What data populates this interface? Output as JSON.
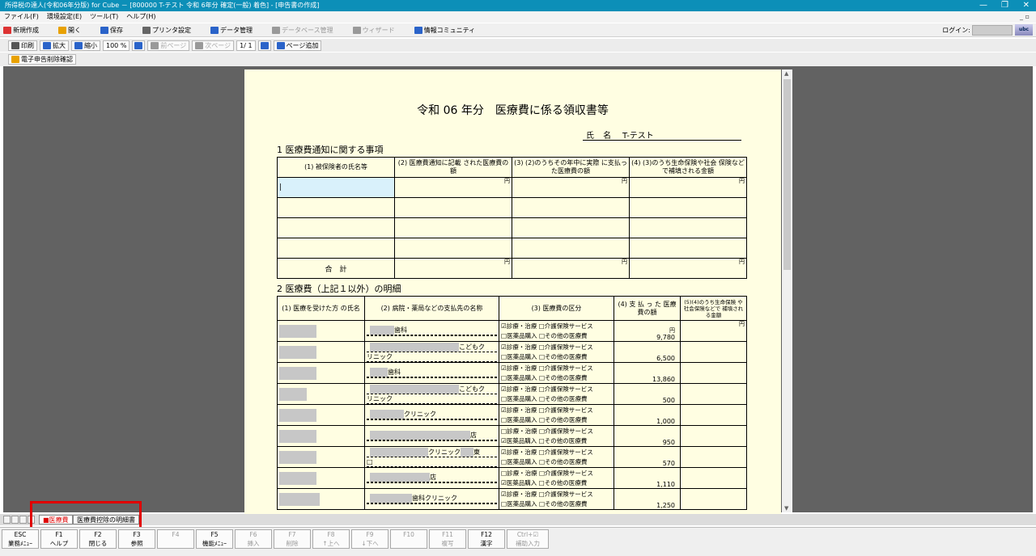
{
  "window": {
    "title": "所得税の達人(令和06年分版) for Cube － [800000 T-テスト 令和 6年分 確定(一般) 着色] - [申告書の作成]",
    "min": "—",
    "restore": "❐",
    "close": "✕"
  },
  "menu": [
    {
      "label": "ファイル(F)"
    },
    {
      "label": "環境設定(E)"
    },
    {
      "label": "ツール(T)"
    },
    {
      "label": "ヘルプ(H)"
    }
  ],
  "mdi_controls": "_ ▫",
  "toolbar1": [
    {
      "label": "新規作成",
      "color": "#d33",
      "disabled": false
    },
    {
      "label": "開く",
      "color": "#e8a100",
      "disabled": false
    },
    {
      "label": "保存",
      "color": "#2a63c9",
      "disabled": false
    },
    {
      "label": "プリンタ設定",
      "color": "#666",
      "disabled": false
    },
    {
      "label": "データ管理",
      "color": "#2a63c9",
      "disabled": false
    },
    {
      "label": "データベース管理",
      "color": "#999",
      "disabled": true
    },
    {
      "label": "ウィザード",
      "color": "#999",
      "disabled": true
    },
    {
      "label": "情報コミュニティ",
      "color": "#2a63c9",
      "disabled": false
    }
  ],
  "login": {
    "label": "ログイン:"
  },
  "toolbar2": {
    "print": "印刷",
    "zoom_in": "拡大",
    "zoom_out": "縮小",
    "zoom_value": "100 %",
    "prev_page": "前ページ",
    "next_page": "次ページ",
    "page_value": "1/ 1",
    "add_page": "ページ追加"
  },
  "toolbar3": {
    "e_filing": "電子申告削除確認"
  },
  "doc": {
    "title": "令和 06 年分　医療費に係る領収書等",
    "name_label": "氏 名",
    "name_value": "T-テスト",
    "section1": "1  医療費通知に関する事項",
    "s1_headers": [
      "(1) 被保険者の氏名等",
      "(2) 医療費通知に記載 された医療費の額",
      "(3) (2)のうちその年中に実際 に支払った医療費の額",
      "(4) (3)のうち生命保険や社会 保険などで補填される金額"
    ],
    "yen": "円",
    "total_label": "合　計",
    "section2": "2  医療費（上記１以外）の明細",
    "s2_headers": [
      "(1) 医療を受けた方 の氏名",
      "(2) 病院・薬局などの支払先の名称",
      "(3) 医療費の区分",
      "(4) 支 払 っ た 医療費の額",
      "(5)(4)のうち生命保険 や社会保険などで 補填される金額"
    ],
    "rows": [
      {
        "payee1": "歯科",
        "payee2": "",
        "kubun1": "☑診療・治療 □介護保険サービス",
        "kubun2": "□医薬品購入 □その他の医療費",
        "amount": "9,780"
      },
      {
        "payee1": "こどもク",
        "payee2": "リニック",
        "kubun1": "☑診療・治療 □介護保険サービス",
        "kubun2": "□医薬品購入 □その他の医療費",
        "amount": "6,500"
      },
      {
        "payee1": "歯科",
        "payee2": "",
        "kubun1": "☑診療・治療 □介護保険サービス",
        "kubun2": "□医薬品購入 □その他の医療費",
        "amount": "13,860"
      },
      {
        "payee1": "こどもク",
        "payee2": "リニック",
        "kubun1": "☑診療・治療 □介護保険サービス",
        "kubun2": "□医薬品購入 □その他の医療費",
        "amount": "500"
      },
      {
        "payee1": "クリニック",
        "payee2": "",
        "kubun1": "☑診療・治療 □介護保険サービス",
        "kubun2": "□医薬品購入 □その他の医療費",
        "amount": "1,000"
      },
      {
        "payee1": "店",
        "payee2": "",
        "kubun1": "□診療・治療 □介護保険サービス",
        "kubun2": "☑医薬品購入 □その他の医療費",
        "amount": "950"
      },
      {
        "payee1": "クリニック",
        "payee1b": "東",
        "payee2": "□",
        "kubun1": "☑診療・治療 □介護保険サービス",
        "kubun2": "□医薬品購入 □その他の医療費",
        "amount": "570"
      },
      {
        "payee1": "店",
        "payee2": "",
        "kubun1": "□診療・治療 □介護保険サービス",
        "kubun2": "☑医薬品購入 □その他の医療費",
        "amount": "1,110"
      },
      {
        "payee1": "歯科クリニック",
        "payee2": "",
        "kubun1": "☑診療・治療 □介護保険サービス",
        "kubun2": "□医薬品購入 □その他の医療費",
        "amount": "1,250"
      }
    ]
  },
  "tabs": [
    {
      "label": "■医療費",
      "active": true
    },
    {
      "label": "医療費控除の明細書",
      "active": false
    }
  ],
  "fkeys": [
    {
      "key": "ESC",
      "label": "業務ﾒﾆｭｰ",
      "disabled": false
    },
    {
      "key": "F1",
      "label": "ヘルプ",
      "disabled": false
    },
    {
      "key": "F2",
      "label": "閉じる",
      "disabled": false
    },
    {
      "key": "F3",
      "label": "参照",
      "disabled": false
    },
    {
      "key": "F4",
      "label": "",
      "disabled": true
    },
    {
      "key": "F5",
      "label": "機能ﾒﾆｭｰ",
      "disabled": false
    },
    {
      "key": "F6",
      "label": "挿入",
      "disabled": true
    },
    {
      "key": "F7",
      "label": "削除",
      "disabled": true
    },
    {
      "key": "F8",
      "label": "↑上へ",
      "disabled": true
    },
    {
      "key": "F9",
      "label": "↓下へ",
      "disabled": true
    },
    {
      "key": "F10",
      "label": "",
      "disabled": true
    },
    {
      "key": "F11",
      "label": "複写",
      "disabled": true
    },
    {
      "key": "F12",
      "label": "漢字",
      "disabled": false
    },
    {
      "key": "Ctrl+☑",
      "label": "補助入力",
      "disabled": true
    }
  ]
}
